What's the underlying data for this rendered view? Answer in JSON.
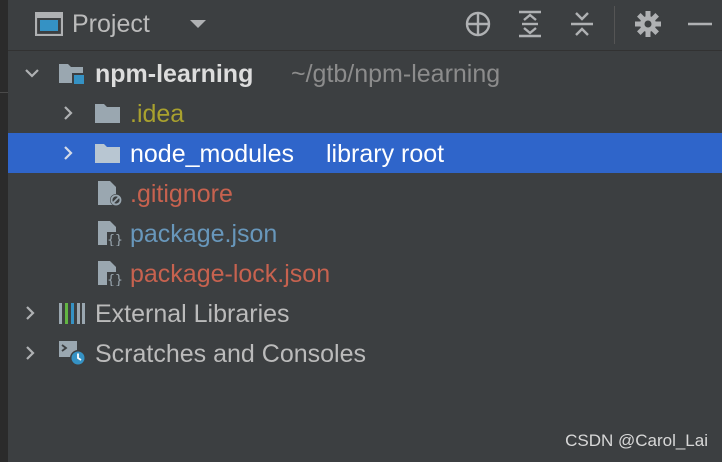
{
  "header": {
    "title": "Project",
    "icons": [
      "project-view-icon",
      "dropdown-arrow-icon",
      "locate-icon",
      "expand-all-icon",
      "collapse-all-icon",
      "gear-icon",
      "minimize-icon"
    ]
  },
  "tree": {
    "root": {
      "name": "npm-learning",
      "path": "~/gtb/npm-learning"
    },
    "children": [
      {
        "label": ".idea",
        "type": "folder",
        "color": "#a9a12e"
      },
      {
        "label": "node_modules",
        "type": "folder",
        "suffix": "library root",
        "color": "#ffffff",
        "selected": true
      },
      {
        "label": ".gitignore",
        "type": "file-ignored",
        "color": "#c7624f"
      },
      {
        "label": "package.json",
        "type": "file-json",
        "color": "#6897bb"
      },
      {
        "label": "package-lock.json",
        "type": "file-json",
        "color": "#c7624f"
      }
    ],
    "external_libraries": "External Libraries",
    "scratches": "Scratches and Consoles"
  },
  "colors": {
    "background": "#3c3f41",
    "selection": "#2f65ca",
    "default_text": "#bbbbbb",
    "muted_text": "#8c8c8c"
  },
  "watermark": "CSDN @Carol_Lai"
}
